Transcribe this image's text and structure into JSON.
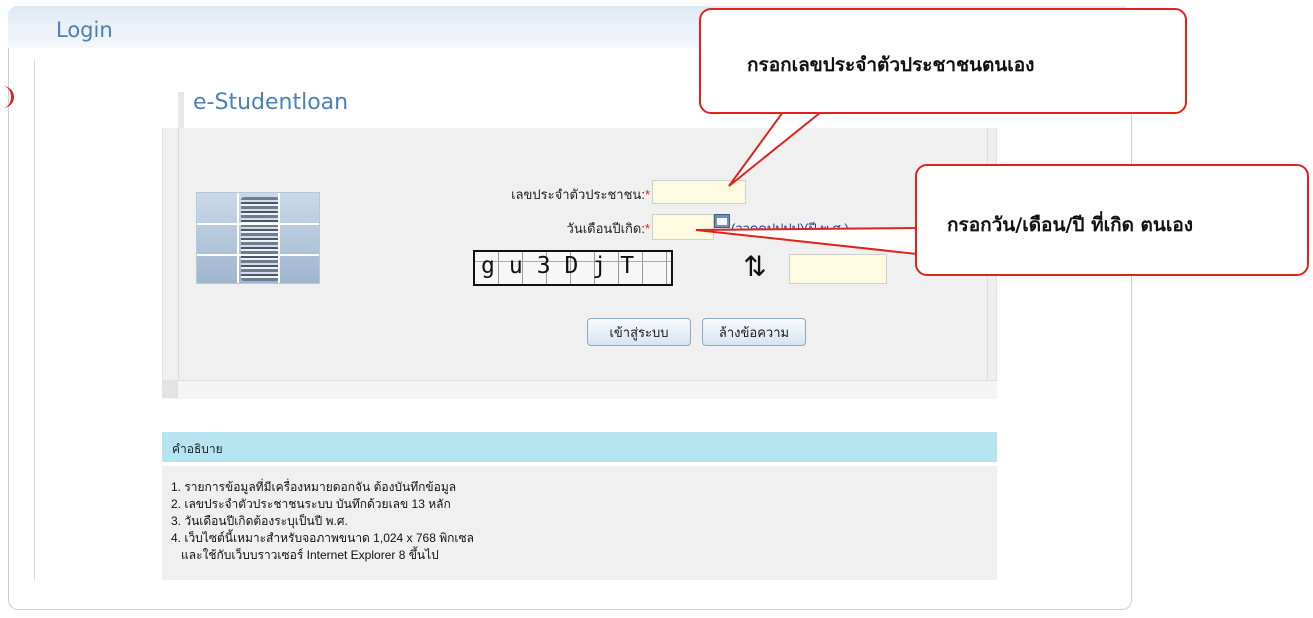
{
  "header": {
    "title": "Login"
  },
  "panel": {
    "brand": "e-Studentloan"
  },
  "form": {
    "id_label": "เลขประจำตัวประชาชน:",
    "birth_label": "วันเดือนปีเกิด:",
    "required_mark": "*",
    "id_value": "",
    "birth_value": "",
    "date_hint": "(ววดดปปปป)(ปี พ.ศ.)",
    "captcha_text": "gu3DjT",
    "captcha_value": "",
    "login_button": "เข้าสู่ระบบ",
    "clear_button": "ล้างข้อความ"
  },
  "description": {
    "title": "คำอธิบาย",
    "lines": [
      "1. รายการข้อมูลที่มีเครื่องหมายดอกจัน ต้องบันทึกข้อมูล",
      "2. เลขประจำตัวประชาชนระบบ บันทึกด้วยเลข 13 หลัก",
      "3. วันเดือนปีเกิดต้องระบุเป็นปี พ.ศ.",
      "4. เว็บไซต์นี้เหมาะสำหรับจอภาพขนาด 1,024 x 768 พิกเซล",
      "   และใช้กับเว็บบราวเซอร์ Internet Explorer 8 ขึ้นไป"
    ]
  },
  "callouts": {
    "id_note": "กรอกเลขประจำตัวประชาชนตนเอง",
    "birth_note": "กรอกวัน/เดือน/ปี ที่เกิด ตนเอง"
  },
  "icons": {
    "calendar": "calendar-icon",
    "refresh": "refresh-captcha-icon",
    "illustration": "books-image"
  },
  "colors": {
    "accent": "#e0241b",
    "title_blue": "#4a7fb8",
    "desc_header": "#b6e4f0",
    "input_bg": "#fffbe0"
  }
}
